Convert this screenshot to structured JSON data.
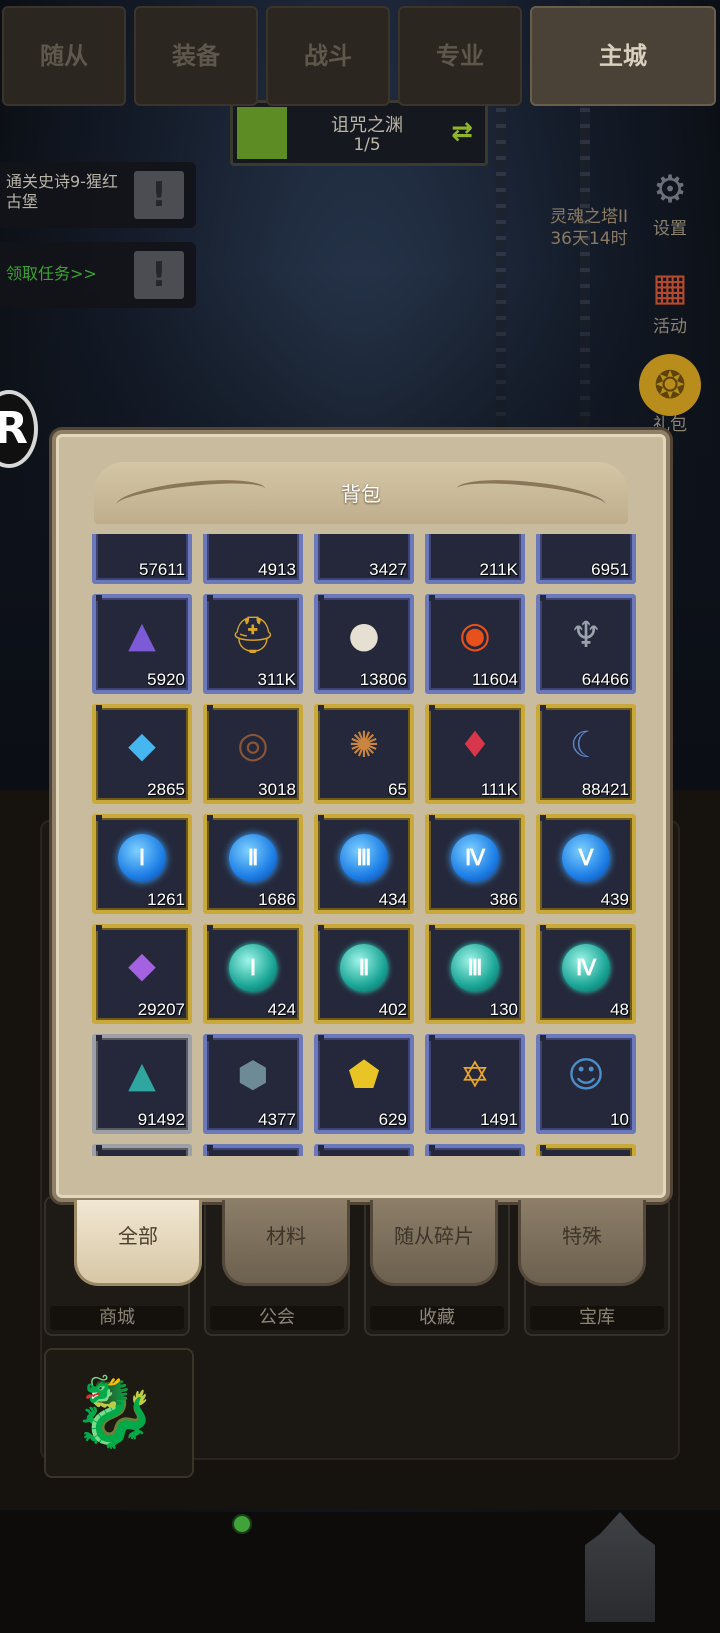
{
  "hud": {
    "zone_name": "诅咒之渊",
    "zone_progress": "1/5",
    "zone_progress_fraction": 0.2,
    "quests": [
      {
        "text": "通关史诗9-猩红古堡"
      },
      {
        "text": "领取任务>>"
      }
    ],
    "tower": {
      "name": "灵魂之塔II",
      "timer": "36天14时"
    },
    "side_buttons": [
      {
        "label": "设置",
        "icon": "gear-icon"
      },
      {
        "label": "活动",
        "icon": "scroll-board-icon"
      },
      {
        "label": "礼包",
        "icon": "gift-pouch-icon"
      }
    ],
    "round_badge": "R"
  },
  "backpack": {
    "title": "背包",
    "rows": [
      [
        {
          "icon": "partial-item-icon",
          "qty": "57611",
          "frame": "blue",
          "color": "#6b78ba"
        },
        {
          "icon": "partial-item-icon",
          "qty": "4913",
          "frame": "blue",
          "color": "#6b78ba"
        },
        {
          "icon": "partial-item-icon",
          "qty": "3427",
          "frame": "blue",
          "color": "#6b78ba"
        },
        {
          "icon": "partial-item-icon",
          "qty": "211K",
          "frame": "blue",
          "color": "#6b78ba"
        },
        {
          "icon": "partial-item-icon",
          "qty": "6951",
          "frame": "blue",
          "color": "#6b78ba"
        }
      ],
      [
        {
          "icon": "purple-ore-pile-icon",
          "qty": "5920",
          "frame": "blue",
          "glyph": "▲",
          "color": "#7d5bd6"
        },
        {
          "icon": "gold-helmet-icon",
          "qty": "311K",
          "frame": "blue",
          "glyph": "⛑",
          "color": "#d9a62a"
        },
        {
          "icon": "pearl-shell-icon",
          "qty": "13806",
          "frame": "blue",
          "glyph": "●",
          "color": "#e6e0d2"
        },
        {
          "icon": "fire-eye-icon",
          "qty": "11604",
          "frame": "blue",
          "glyph": "◉",
          "color": "#e8501c"
        },
        {
          "icon": "horned-helmet-icon",
          "qty": "64466",
          "frame": "blue",
          "glyph": "♆",
          "color": "#9aa2ac"
        }
      ],
      [
        {
          "icon": "blue-crystal-icon",
          "qty": "2865",
          "frame": "gold",
          "glyph": "◆",
          "color": "#46b6f0"
        },
        {
          "icon": "dark-swirl-orb-icon",
          "qty": "3018",
          "frame": "gold",
          "glyph": "◎",
          "color": "#8a5637"
        },
        {
          "icon": "bronze-swirl-orb-icon",
          "qty": "65",
          "frame": "gold",
          "glyph": "✺",
          "color": "#c9843f"
        },
        {
          "icon": "blood-crystal-icon",
          "qty": "111K",
          "frame": "gold",
          "glyph": "♦",
          "color": "#d8364a"
        },
        {
          "icon": "blue-claw-icon",
          "qty": "88421",
          "frame": "gold",
          "glyph": "☾",
          "color": "#5f87c9"
        }
      ],
      [
        {
          "icon": "rune-orb-i-blue-icon",
          "qty": "1261",
          "frame": "gold",
          "roman": "Ⅰ",
          "tone": "blue"
        },
        {
          "icon": "rune-orb-ii-blue-icon",
          "qty": "1686",
          "frame": "gold",
          "roman": "Ⅱ",
          "tone": "blue"
        },
        {
          "icon": "rune-orb-iii-blue-icon",
          "qty": "434",
          "frame": "gold",
          "roman": "Ⅲ",
          "tone": "blue"
        },
        {
          "icon": "rune-orb-iv-blue-icon",
          "qty": "386",
          "frame": "gold",
          "roman": "Ⅳ",
          "tone": "blue"
        },
        {
          "icon": "rune-orb-v-blue-icon",
          "qty": "439",
          "frame": "gold",
          "roman": "Ⅴ",
          "tone": "blue"
        }
      ],
      [
        {
          "icon": "violet-shard-icon",
          "qty": "29207",
          "frame": "gold",
          "glyph": "◆",
          "color": "#a461e0"
        },
        {
          "icon": "rune-orb-i-teal-icon",
          "qty": "424",
          "frame": "gold",
          "roman": "Ⅰ",
          "tone": "teal"
        },
        {
          "icon": "rune-orb-ii-teal-icon",
          "qty": "402",
          "frame": "gold",
          "roman": "Ⅱ",
          "tone": "teal"
        },
        {
          "icon": "rune-orb-iii-teal-icon",
          "qty": "130",
          "frame": "gold",
          "roman": "Ⅲ",
          "tone": "teal"
        },
        {
          "icon": "rune-orb-iv-teal-icon",
          "qty": "48",
          "frame": "gold",
          "roman": "Ⅳ",
          "tone": "teal"
        }
      ],
      [
        {
          "icon": "teal-ore-pile-icon",
          "qty": "91492",
          "frame": "gray",
          "glyph": "▲",
          "color": "#2fa6a0"
        },
        {
          "icon": "stone-chunk-icon",
          "qty": "4377",
          "frame": "blue",
          "glyph": "⬢",
          "color": "#6e8a97"
        },
        {
          "icon": "gold-gem-icon",
          "qty": "629",
          "frame": "blue",
          "glyph": "⬟",
          "color": "#e8c424"
        },
        {
          "icon": "star-badge-icon",
          "qty": "1491",
          "frame": "blue",
          "glyph": "✡",
          "color": "#eaa52c"
        },
        {
          "icon": "hero-portrait-icon",
          "qty": "10",
          "frame": "blue",
          "glyph": "☺",
          "color": "#4c8ec9"
        }
      ],
      [
        {
          "icon": "partial-item-icon",
          "qty": "",
          "frame": "gray",
          "glyph": "◆",
          "color": "#8fb2d8"
        },
        {
          "icon": "partial-item-icon",
          "qty": "",
          "frame": "blue",
          "glyph": "●",
          "color": "#d89a6a"
        },
        {
          "icon": "partial-item-icon",
          "qty": "",
          "frame": "blue",
          "glyph": "♛",
          "color": "#9aa2ac"
        },
        {
          "icon": "partial-item-icon",
          "qty": "",
          "frame": "blue",
          "glyph": "▲",
          "color": "#8a93a0"
        },
        {
          "icon": "partial-item-icon",
          "qty": "",
          "frame": "gold",
          "glyph": "♜",
          "color": "#b06a3c"
        }
      ]
    ]
  },
  "categories": [
    {
      "label": "全部",
      "active": true
    },
    {
      "label": "材料",
      "active": false
    },
    {
      "label": "随从碎片",
      "active": false
    },
    {
      "label": "特殊",
      "active": false
    }
  ],
  "facilities": [
    {
      "label": "商城"
    },
    {
      "label": "公会"
    },
    {
      "label": "收藏"
    },
    {
      "label": "宝库"
    }
  ],
  "bottom_nav": [
    {
      "label": "随从",
      "active": false
    },
    {
      "label": "装备",
      "active": false
    },
    {
      "label": "战斗",
      "active": false
    },
    {
      "label": "专业",
      "active": false
    },
    {
      "label": "主城",
      "active": true
    }
  ]
}
